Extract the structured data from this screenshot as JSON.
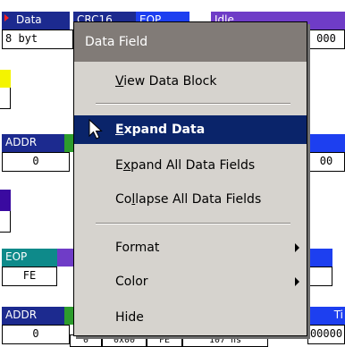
{
  "background_rows": {
    "row1": {
      "data_label": "Data",
      "code_label": "CRC16",
      "eop_label": "EOP",
      "idle_label": "Idle",
      "value": "8 byt",
      "right_value": "000"
    },
    "row3": {
      "addr_label": "ADDR",
      "addr_value": "0",
      "right_value": "00"
    },
    "row5": {
      "eop_label": "EOP",
      "eop_value": "FE"
    },
    "row6": {
      "addr_label": "ADDR",
      "addr_value": "0",
      "time_label": "Ti",
      "mid_values": [
        "0",
        "0x00",
        "FE",
        "107 ns"
      ],
      "time_value": "00000"
    }
  },
  "colors": {
    "header_navy": "#1c2a8f",
    "green_strip": "#2d9c2d",
    "teal_strip": "#0e8a8a",
    "purple_strip": "#6f3cc7",
    "blue_strip": "#1d3ff0",
    "yellow_bar": "#f4f400",
    "indigo_bar": "#3a0aa0",
    "menu_bg": "#d6d3ce",
    "menu_title_bg": "#817b77",
    "selection": "#0a246a"
  },
  "context_menu": {
    "title": "Data Field",
    "items": [
      {
        "label": "View Data Block",
        "accel": "V",
        "rest": "iew Data Block"
      },
      {
        "label": "Expand Data",
        "accel": "E",
        "rest": "xpand Data"
      },
      {
        "label": "Expand All Data Fields",
        "pre": "E",
        "accel": "x",
        "rest": "pand All Data Fields"
      },
      {
        "label": "Collapse All Data Fields",
        "pre": "Co",
        "accel": "l",
        "rest": "lapse All Data Fields"
      },
      {
        "label": "Format"
      },
      {
        "label": "Color"
      },
      {
        "label": "Hide"
      }
    ]
  }
}
